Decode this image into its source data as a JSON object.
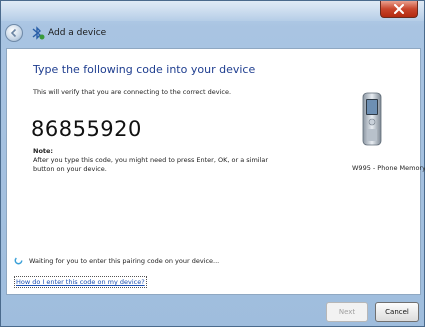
{
  "window": {
    "nav_title": "Add a device"
  },
  "main": {
    "heading": "Type the following code into your device",
    "subtitle": "This will verify that you are connecting to the correct device.",
    "code": "86855920",
    "note_label": "Note:",
    "note_text": "After you type this code, you might need to press Enter, OK, or a similar button on your device.",
    "device_name": "W995 - Phone Memory",
    "waiting_text": "Waiting for you to enter this pairing code on your device...",
    "help_link": "How do I enter this code on my device?"
  },
  "footer": {
    "next_label": "Next",
    "cancel_label": "Cancel"
  },
  "colors": {
    "heading": "#1e3d8f",
    "link": "#1a4fb3",
    "close": "#c8452c"
  },
  "icons": {
    "back": "back-arrow-icon",
    "bluetooth": "bluetooth-icon",
    "close": "close-icon",
    "device": "phone-icon",
    "spinner": "spinner-icon"
  }
}
